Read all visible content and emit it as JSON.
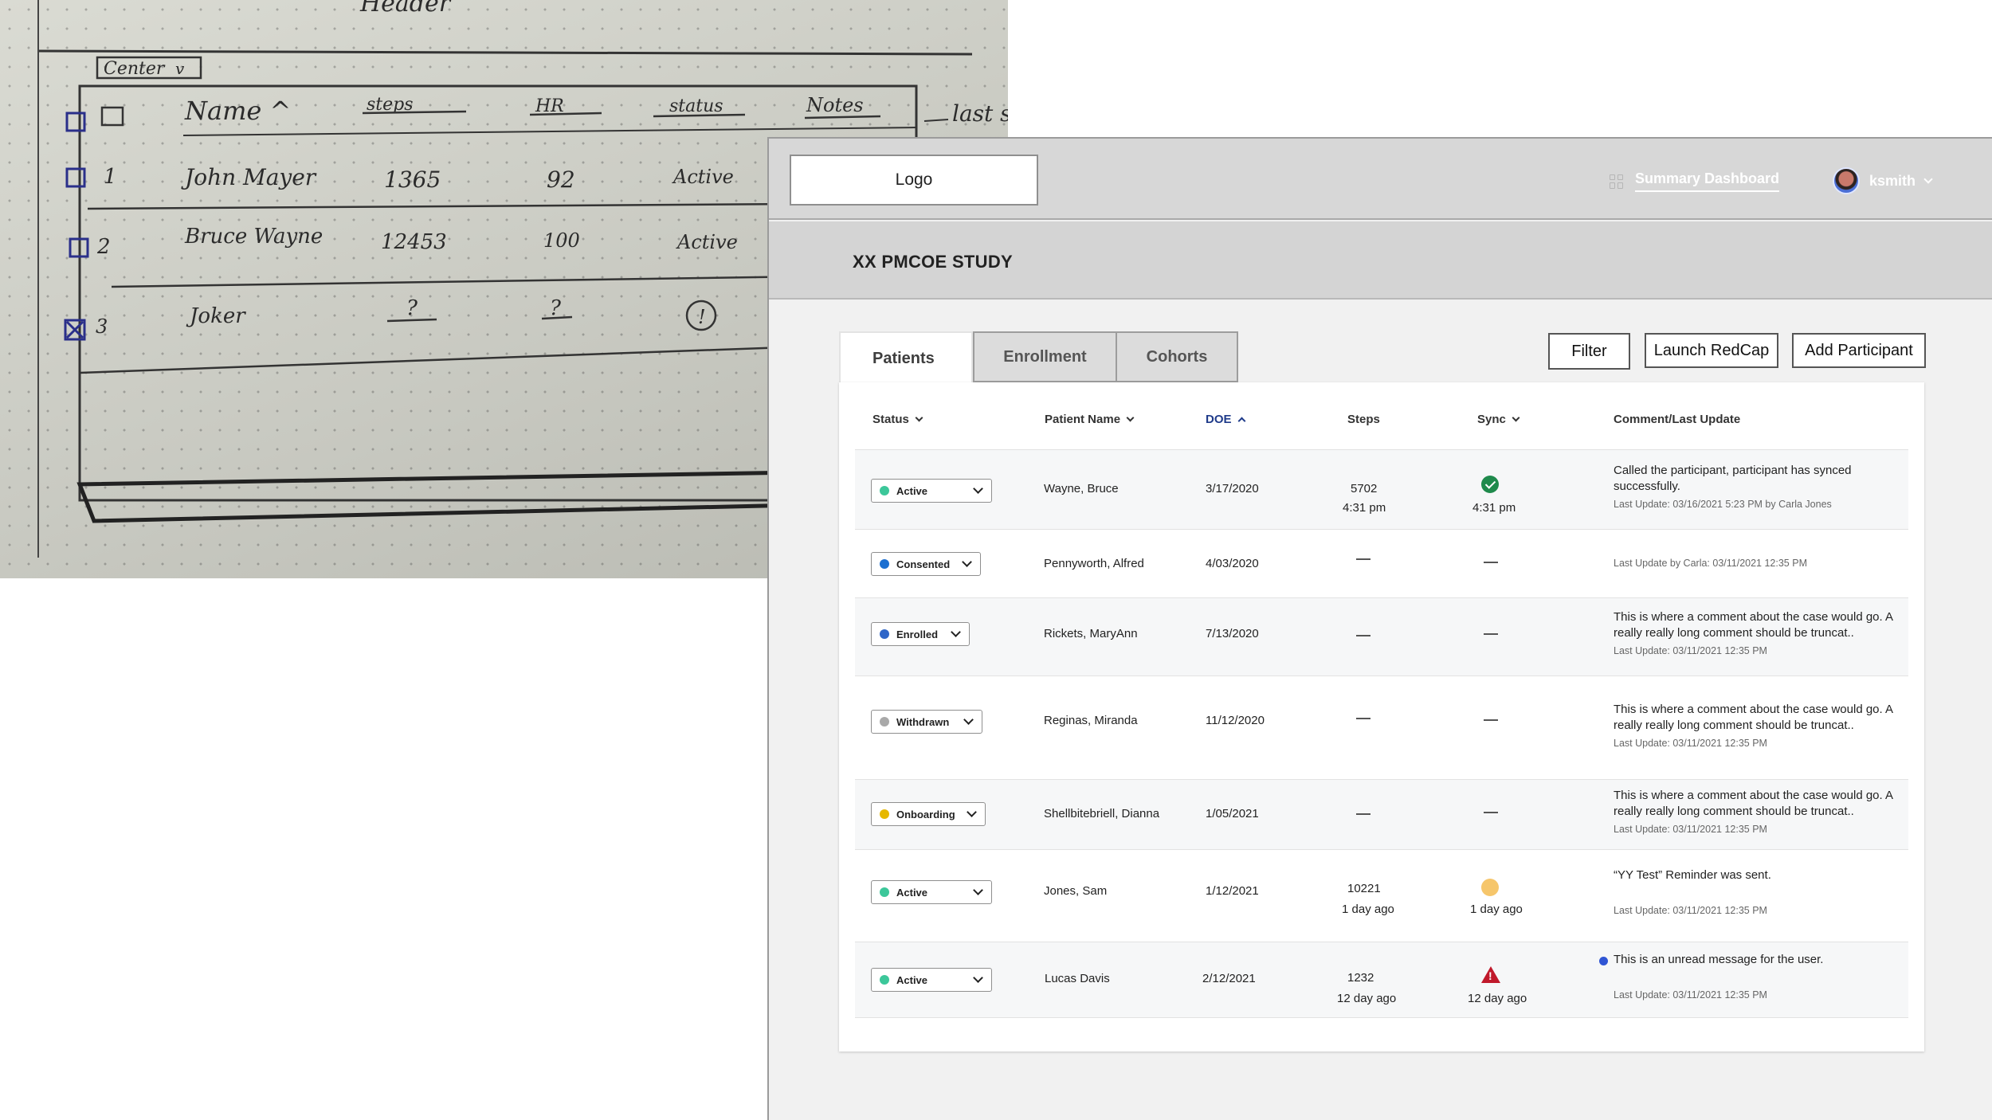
{
  "sketch": {
    "header": "Header",
    "dropdown": "Center",
    "columns": [
      "Name ^",
      "steps",
      "HR",
      "status",
      "Notes",
      "last s"
    ],
    "rows": [
      {
        "num": "1",
        "name": "John Mayer",
        "steps": "1365",
        "hr": "92",
        "status": "Active"
      },
      {
        "num": "2",
        "name": "Bruce Wayne",
        "steps": "12453",
        "hr": "100",
        "status": "Active"
      },
      {
        "num": "3",
        "name": "Joker",
        "steps": "?",
        "hr": "?",
        "status": "!"
      }
    ]
  },
  "app": {
    "logo": "Logo",
    "nav_dashboard": "Summary Dashboard",
    "username": "ksmith",
    "study_title": "XX PMCOE STUDY",
    "tabs": [
      "Patients",
      "Enrollment",
      "Cohorts"
    ],
    "buttons": {
      "filter": "Filter",
      "launch": "Launch RedCap",
      "add": "Add Participant"
    },
    "columns": {
      "status": "Status",
      "name": "Patient Name",
      "doe": "DOE",
      "steps": "Steps",
      "sync": "Sync",
      "comment": "Comment/Last Update"
    },
    "colors": {
      "active": "#3cc79a",
      "consented": "#1b6fd1",
      "enrolled": "#2f66c8",
      "withdrawn": "#a9a9a9",
      "onboarding": "#e6b800"
    },
    "rows": [
      {
        "status": "Active",
        "name": "Wayne, Bruce",
        "doe": "3/17/2020",
        "steps": "5702",
        "steps_sub": "4:31 pm",
        "sync_icon": "check-circle-icon",
        "sync_sub": "4:31 pm",
        "comment": "Called the participant, participant has synced successfully.",
        "update": "Last Update: 03/16/2021 5:23 PM by Carla Jones"
      },
      {
        "status": "Consented",
        "name": "Pennyworth, Alfred",
        "doe": "4/03/2020",
        "steps": "—",
        "sync": "—",
        "update": "Last Update by Carla: 03/11/2021 12:35 PM"
      },
      {
        "status": "Enrolled",
        "name": "Rickets, MaryAnn",
        "doe": "7/13/2020",
        "steps": "—",
        "sync": "—",
        "comment": "This is where a comment about the case would go. A really really long comment should be truncat..",
        "update": "Last Update: 03/11/2021 12:35 PM"
      },
      {
        "status": "Withdrawn",
        "name": "Reginas, Miranda",
        "doe": "11/12/2020",
        "steps": "—",
        "sync": "—",
        "comment": "This is where a comment about the case would go. A really really long comment should be truncat..",
        "update": "Last Update: 03/11/2021 12:35 PM"
      },
      {
        "status": "Onboarding",
        "name": "Shellbitebriell, Dianna",
        "doe": "1/05/2021",
        "steps": "—",
        "sync": "—",
        "comment": "This is where a comment about the case would go. A really really long comment should be truncat..",
        "update": "Last Update: 03/11/2021 12:35 PM"
      },
      {
        "status": "Active",
        "name": "Jones, Sam",
        "doe": "1/12/2021",
        "steps": "10221",
        "steps_sub": "1 day ago",
        "sync_icon": "warning-circle-icon",
        "sync_sub": "1 day ago",
        "comment": "“YY Test” Reminder was sent.",
        "update": "Last Update: 03/11/2021 12:35 PM"
      },
      {
        "status": "Active",
        "name": "Lucas Davis",
        "doe": "2/12/2021",
        "steps": "1232",
        "steps_sub": "12 day ago",
        "sync_icon": "alert-triangle-icon",
        "sync_sub": "12 day ago",
        "comment": "This is an unread message for the user.",
        "update": "Last Update: 03/11/2021 12:35 PM"
      }
    ]
  }
}
